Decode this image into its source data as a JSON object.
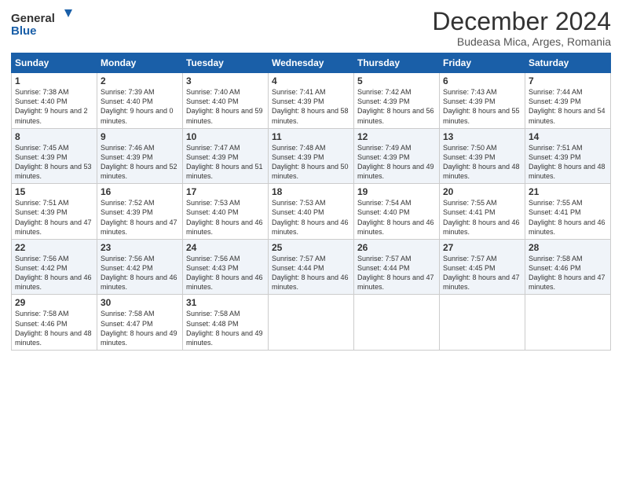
{
  "logo": {
    "line1": "General",
    "line2": "Blue"
  },
  "title": "December 2024",
  "subtitle": "Budeasa Mica, Arges, Romania",
  "weekdays": [
    "Sunday",
    "Monday",
    "Tuesday",
    "Wednesday",
    "Thursday",
    "Friday",
    "Saturday"
  ],
  "weeks": [
    [
      {
        "day": "1",
        "sunrise": "Sunrise: 7:38 AM",
        "sunset": "Sunset: 4:40 PM",
        "daylight": "Daylight: 9 hours and 2 minutes."
      },
      {
        "day": "2",
        "sunrise": "Sunrise: 7:39 AM",
        "sunset": "Sunset: 4:40 PM",
        "daylight": "Daylight: 9 hours and 0 minutes."
      },
      {
        "day": "3",
        "sunrise": "Sunrise: 7:40 AM",
        "sunset": "Sunset: 4:40 PM",
        "daylight": "Daylight: 8 hours and 59 minutes."
      },
      {
        "day": "4",
        "sunrise": "Sunrise: 7:41 AM",
        "sunset": "Sunset: 4:39 PM",
        "daylight": "Daylight: 8 hours and 58 minutes."
      },
      {
        "day": "5",
        "sunrise": "Sunrise: 7:42 AM",
        "sunset": "Sunset: 4:39 PM",
        "daylight": "Daylight: 8 hours and 56 minutes."
      },
      {
        "day": "6",
        "sunrise": "Sunrise: 7:43 AM",
        "sunset": "Sunset: 4:39 PM",
        "daylight": "Daylight: 8 hours and 55 minutes."
      },
      {
        "day": "7",
        "sunrise": "Sunrise: 7:44 AM",
        "sunset": "Sunset: 4:39 PM",
        "daylight": "Daylight: 8 hours and 54 minutes."
      }
    ],
    [
      {
        "day": "8",
        "sunrise": "Sunrise: 7:45 AM",
        "sunset": "Sunset: 4:39 PM",
        "daylight": "Daylight: 8 hours and 53 minutes."
      },
      {
        "day": "9",
        "sunrise": "Sunrise: 7:46 AM",
        "sunset": "Sunset: 4:39 PM",
        "daylight": "Daylight: 8 hours and 52 minutes."
      },
      {
        "day": "10",
        "sunrise": "Sunrise: 7:47 AM",
        "sunset": "Sunset: 4:39 PM",
        "daylight": "Daylight: 8 hours and 51 minutes."
      },
      {
        "day": "11",
        "sunrise": "Sunrise: 7:48 AM",
        "sunset": "Sunset: 4:39 PM",
        "daylight": "Daylight: 8 hours and 50 minutes."
      },
      {
        "day": "12",
        "sunrise": "Sunrise: 7:49 AM",
        "sunset": "Sunset: 4:39 PM",
        "daylight": "Daylight: 8 hours and 49 minutes."
      },
      {
        "day": "13",
        "sunrise": "Sunrise: 7:50 AM",
        "sunset": "Sunset: 4:39 PM",
        "daylight": "Daylight: 8 hours and 48 minutes."
      },
      {
        "day": "14",
        "sunrise": "Sunrise: 7:51 AM",
        "sunset": "Sunset: 4:39 PM",
        "daylight": "Daylight: 8 hours and 48 minutes."
      }
    ],
    [
      {
        "day": "15",
        "sunrise": "Sunrise: 7:51 AM",
        "sunset": "Sunset: 4:39 PM",
        "daylight": "Daylight: 8 hours and 47 minutes."
      },
      {
        "day": "16",
        "sunrise": "Sunrise: 7:52 AM",
        "sunset": "Sunset: 4:39 PM",
        "daylight": "Daylight: 8 hours and 47 minutes."
      },
      {
        "day": "17",
        "sunrise": "Sunrise: 7:53 AM",
        "sunset": "Sunset: 4:40 PM",
        "daylight": "Daylight: 8 hours and 46 minutes."
      },
      {
        "day": "18",
        "sunrise": "Sunrise: 7:53 AM",
        "sunset": "Sunset: 4:40 PM",
        "daylight": "Daylight: 8 hours and 46 minutes."
      },
      {
        "day": "19",
        "sunrise": "Sunrise: 7:54 AM",
        "sunset": "Sunset: 4:40 PM",
        "daylight": "Daylight: 8 hours and 46 minutes."
      },
      {
        "day": "20",
        "sunrise": "Sunrise: 7:55 AM",
        "sunset": "Sunset: 4:41 PM",
        "daylight": "Daylight: 8 hours and 46 minutes."
      },
      {
        "day": "21",
        "sunrise": "Sunrise: 7:55 AM",
        "sunset": "Sunset: 4:41 PM",
        "daylight": "Daylight: 8 hours and 46 minutes."
      }
    ],
    [
      {
        "day": "22",
        "sunrise": "Sunrise: 7:56 AM",
        "sunset": "Sunset: 4:42 PM",
        "daylight": "Daylight: 8 hours and 46 minutes."
      },
      {
        "day": "23",
        "sunrise": "Sunrise: 7:56 AM",
        "sunset": "Sunset: 4:42 PM",
        "daylight": "Daylight: 8 hours and 46 minutes."
      },
      {
        "day": "24",
        "sunrise": "Sunrise: 7:56 AM",
        "sunset": "Sunset: 4:43 PM",
        "daylight": "Daylight: 8 hours and 46 minutes."
      },
      {
        "day": "25",
        "sunrise": "Sunrise: 7:57 AM",
        "sunset": "Sunset: 4:44 PM",
        "daylight": "Daylight: 8 hours and 46 minutes."
      },
      {
        "day": "26",
        "sunrise": "Sunrise: 7:57 AM",
        "sunset": "Sunset: 4:44 PM",
        "daylight": "Daylight: 8 hours and 47 minutes."
      },
      {
        "day": "27",
        "sunrise": "Sunrise: 7:57 AM",
        "sunset": "Sunset: 4:45 PM",
        "daylight": "Daylight: 8 hours and 47 minutes."
      },
      {
        "day": "28",
        "sunrise": "Sunrise: 7:58 AM",
        "sunset": "Sunset: 4:46 PM",
        "daylight": "Daylight: 8 hours and 47 minutes."
      }
    ],
    [
      {
        "day": "29",
        "sunrise": "Sunrise: 7:58 AM",
        "sunset": "Sunset: 4:46 PM",
        "daylight": "Daylight: 8 hours and 48 minutes."
      },
      {
        "day": "30",
        "sunrise": "Sunrise: 7:58 AM",
        "sunset": "Sunset: 4:47 PM",
        "daylight": "Daylight: 8 hours and 49 minutes."
      },
      {
        "day": "31",
        "sunrise": "Sunrise: 7:58 AM",
        "sunset": "Sunset: 4:48 PM",
        "daylight": "Daylight: 8 hours and 49 minutes."
      },
      null,
      null,
      null,
      null
    ]
  ]
}
